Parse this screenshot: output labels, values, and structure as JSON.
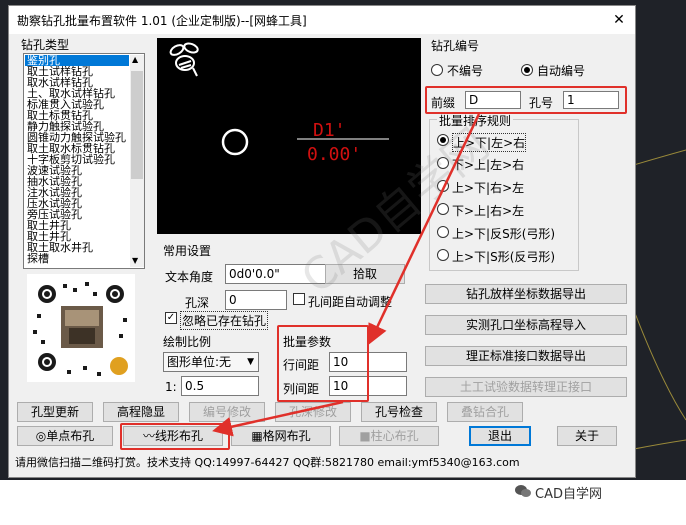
{
  "window": {
    "title": "勘察钻孔批量布置软件 1.01 (企业定制版)--[网蜂工具]",
    "close_glyph": "✕"
  },
  "drill_type": {
    "group_label": "钻孔类型",
    "items": [
      "鉴别孔",
      "取土试样钻孔",
      "取水试样钻孔",
      "土、取水试样钻孔",
      "标准贯入试验孔",
      "取土标贯钻孔",
      "静力触探试验孔",
      "圆锥动力触探试验孔",
      "取土取水标贯钻孔",
      "十字板剪切试验孔",
      "波速试验孔",
      "抽水试验孔",
      "注水试验孔",
      "压水试验孔",
      "旁压试验孔",
      "取土井孔",
      "取土井孔",
      "取土取水井孔",
      "探槽"
    ],
    "selected_index": 0
  },
  "preview": {
    "label_d": "D1'",
    "label_v": "0.00'",
    "watermark": "CAD自学网"
  },
  "common": {
    "group_label": "常用设置",
    "angle_label": "文本角度",
    "angle_value": "0d0'0.0\"",
    "pick_button": "拾取",
    "depth_label": "孔深",
    "depth_value": "0",
    "auto_spacing_label": "孔间距自动调整",
    "ignore_existing_label": "忽略已存在钻孔"
  },
  "scale": {
    "group_label": "绘制比例",
    "unit_select": "图形单位:无",
    "ratio_prefix": "1:",
    "ratio_value": "0.5"
  },
  "batch": {
    "group_label": "批量参数",
    "row_label": "行间距",
    "row_value": "10",
    "col_label": "列间距",
    "col_value": "10"
  },
  "numbering": {
    "group_label": "钻孔编号",
    "no_number": "不编号",
    "auto_number": "自动编号",
    "prefix_label": "前缀",
    "prefix_value": "D",
    "hole_label": "孔号",
    "hole_value": "1"
  },
  "sort": {
    "group_label": "批量排序规则",
    "options": [
      "上>下|左>右",
      "下>上|左>右",
      "上>下|右>左",
      "下>上|右>左",
      "上>下|反S形(弓形)",
      "上>下|S形(反弓形)"
    ],
    "selected_index": 0
  },
  "right_buttons": [
    "钻孔放样坐标数据导出",
    "实测孔口坐标高程导入",
    "理正标准接口数据导出",
    "土工试验数据转理正接口"
  ],
  "row1_buttons": [
    "孔型更新",
    "高程隐显",
    "编号修改",
    "孔深修改",
    "孔号检查",
    "叠钻合孔"
  ],
  "row2_buttons": [
    "◎单点布孔",
    "〰线形布孔",
    "▦格网布孔",
    "■柱心布孔",
    "退出",
    "关于"
  ],
  "footer": "请用微信扫描二维码打赏。技术支持 QQ:14997-64427 QQ群:5821780 email:ymf5340@163.com",
  "page_watermark": "CAD自学网"
}
